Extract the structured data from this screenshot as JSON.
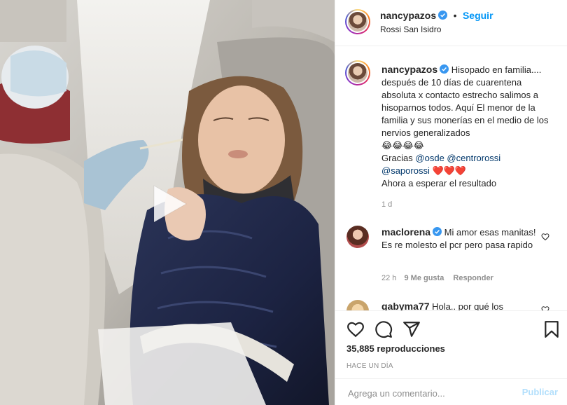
{
  "post": {
    "username": "nancypazos",
    "follow_label": "Seguir",
    "separator": "•",
    "location": "Rossi San Isidro"
  },
  "caption": {
    "username": "nancypazos",
    "text": "Hisopado en familia.... después de 10 días de cuarentena absoluta x contacto estrecho salimos a hisoparnos todos. Aquí El menor de la familia y sus monerías en el medio de los nervios generalizados",
    "emojis": "😂😂😂😂",
    "thanks_prefix": "Gracias ",
    "mention_1": "@osde",
    "mention_2": "@centrorossi",
    "mention_3": "@saporossi",
    "hearts": "❤️❤️❤️",
    "closing": "Ahora a esperar el resultado",
    "age": "1 d"
  },
  "comments": [
    {
      "username": "maclorena",
      "text": "Mi amor esas manitas! Es re molesto el pcr pero pasa rapido",
      "age": "22 h",
      "likes": "9 Me gusta",
      "reply": "Responder"
    },
    {
      "username": "gabyma77",
      "text": "Hola.. por qué los"
    }
  ],
  "actions": {
    "views": "35,885 reproducciones",
    "time": "HACE UN DÍA"
  },
  "comment_box": {
    "placeholder": "Agrega un comentario...",
    "post_label": "Publicar"
  },
  "icons": {
    "like": "heart-icon",
    "comment": "comment-icon",
    "share": "share-icon",
    "save": "bookmark-icon",
    "play": "play-icon",
    "verified": "verified-badge-icon"
  },
  "colors": {
    "link": "#0095f6",
    "mention": "#00376b",
    "muted": "#8e8e8e",
    "text": "#262626",
    "post_disabled": "#b2dffc"
  }
}
